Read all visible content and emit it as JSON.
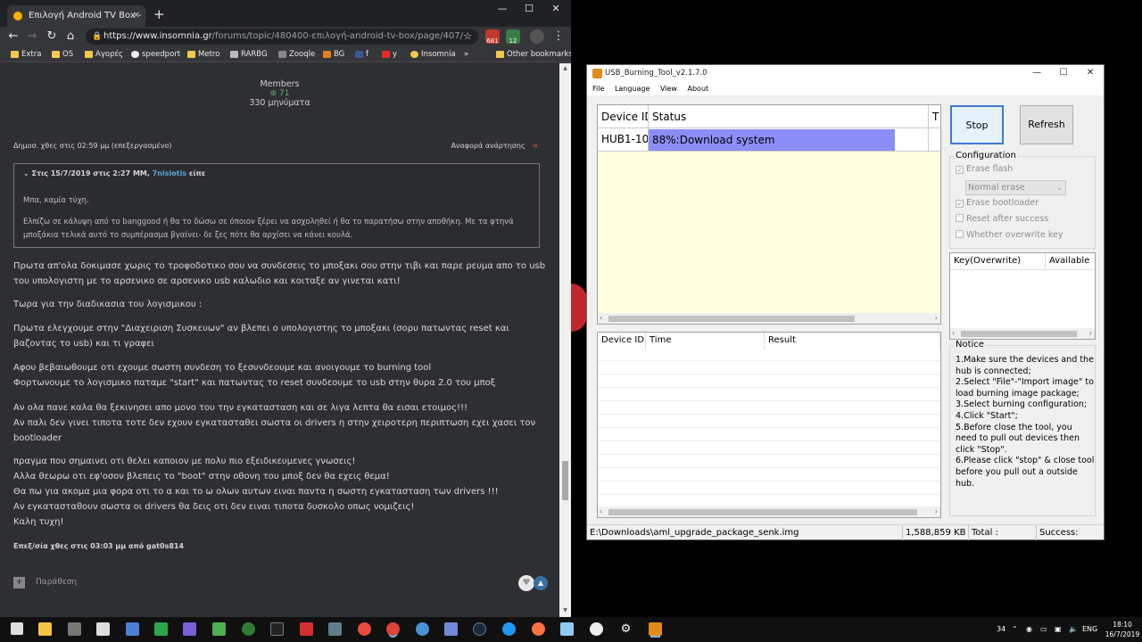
{
  "chrome": {
    "tab_title": "Επιλογή Android TV Box - Σελίδ",
    "tab_close": "✕",
    "new_tab": "+",
    "url_host": "https://www.insomnia.gr",
    "url_path": "/forums/topic/480400-επιλογή-android-tv-box/page/407/",
    "ext_badges": [
      "681",
      "12"
    ],
    "bookmarks": [
      "Extra",
      "OS",
      "Αγορές",
      "speedport",
      "Metro",
      "RARBG",
      "Zooqle",
      "BG",
      "f",
      "y",
      "Insomnia"
    ],
    "bookmarks_more": "»",
    "other_bookmarks": "Other bookmarks"
  },
  "post": {
    "member_group": "Members",
    "reputation": "71",
    "message_count": "330 μηνύματα",
    "posted": "Δημοσ. χθες στις 02:59 μμ (επεξεργασμένο)",
    "report": "Αναφορά ανάρτησης",
    "quote_date": "Στις 15/7/2019 στις 2:27 ΜΜ,",
    "quote_user": "7nisiotis",
    "quote_said": "είπε",
    "quote_line1": "Μπα, καμία τύχη.",
    "quote_line2": "Ελπίζω σε κάλυψη από το banggood ή θα το δώσω σε όποιον ξέρει να ασχοληθεί ή θα το παρατήσω στην αποθήκη. Με τα φτηνά μποξάκια τελικά αυτό το συμπέρασμα βγαίνει- δε ξες πότε θα αρχίσει να κάνει κουλά.",
    "paragraphs": [
      "Πρωτα απ'ολα δοκιμασε χωρις το τροφοδοτικο σου να συνδεσεις το μποξακι σου στην τιβι και παρε ρευμα απο το usb του υπολογιστη με το αρσενικο σε αρσενικο usb καλωδιο και κοιταξε αν γινεται κατι!",
      "Τωρα για την διαδικασια του λογισμικου :",
      "Πρωτα ελεγχουμε στην \"Διαχειριση Συσκευων\" αν βλεπει  ο υπολογιστης το μποξακι  (σορυ πατωντας reset και βαζοντας το usb) και τι γραφει",
      "Αφου βεβαιωθουμε οτι εχουμε σωστη συνδεση το ξεσυνδεουμε και ανοιγουμε το burning tool\nΦορτωνουμε το λογισμικο παταμε \"start\" και πατωντας το reset συνδεουμε το usb στην θυρα 2.0 του μποξ",
      "Αν ολα πανε καλα θα ξεκινησει απο μονο του την εγκατασταση και σε λιγα λεπτα θα εισαι ετοιμος!!!\nΑν παλι δεν γινει τιποτα τοτε δεν εχουν εγκατασταθει σωστα οι drivers η στην χειροτερη περιπτωση εχει χασει τον bootloader",
      "πραγμα που σημαινει οτι θελει καποιον με πολυ πιο εξειδικευμενες γνωσεις!\nΑλλα θεωρω οτι εφ'οσον βλεπεις το \"boot\" στην οθονη του μποξ δεν θα εχεις θεμα!\nΘα πω για ακομα μια φορα οτι το α και το ω ολων αυτων ειναι παντα η σωστη εγκατασταση των drivers !!!\nΑν εγκατασταθουν σωστα οι drivers θα δεις οτι δεν ειναι τιποτα δυσκολο οπως νομιζεις!\nΚαλη τυχη!"
    ],
    "edited": "Επεξ/σία χθες στις 03:03 μμ από gat0s814",
    "quote_button": "Παράθεση"
  },
  "ubt": {
    "title": "USB_Burning_Tool_v2.1.7.0",
    "menu": [
      "File",
      "Language",
      "View",
      "About"
    ],
    "device_headers": [
      "Device ID",
      "Status",
      "T"
    ],
    "device_row": {
      "id": "HUB1-10",
      "status": "88%:Download system"
    },
    "log_headers": [
      "Device ID",
      "Time",
      "Result"
    ],
    "stop_label": "Stop",
    "refresh_label": "Refresh",
    "config_label": "Configuration",
    "erase_flash": "Erase flash",
    "erase_mode": "Normal erase",
    "erase_bootloader": "Erase bootloader",
    "reset_after_success": "Reset after success",
    "overwrite_key": "Whether overwrite key",
    "key_headers": [
      "Key(Overwrite)",
      "Available"
    ],
    "notice_label": "Notice",
    "notice_text": "1.Make sure the devices and the hub is connected;\n2.Select \"File\"-\"Import image\" to load burning image package;\n3.Select burning configuration;\n4.Click \"Start\";\n5.Before close the tool, you need to pull out devices then click \"Stop\".\n6.Please click \"stop\" & close tool before you pull out a outside hub.",
    "status_path": "E:\\Downloads\\aml_upgrade_package_senk.img",
    "status_size": "1,588,859 KB",
    "status_total": "Total :",
    "status_success": "Success:"
  },
  "taskbar": {
    "tray_number": "34",
    "lang": "ENG",
    "time": "18:10",
    "date": "16/7/2019"
  },
  "colors": {
    "progress": "#8b8ef8",
    "device_bg": "#ffffe0",
    "accent": "#3d7ad6"
  }
}
